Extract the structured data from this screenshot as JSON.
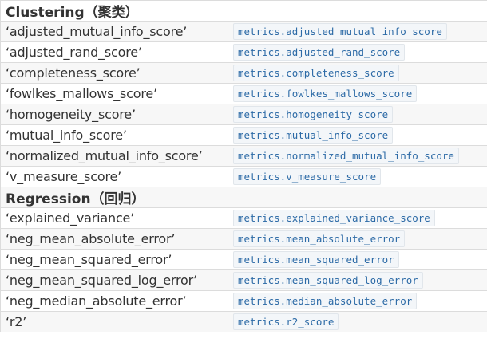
{
  "sections": [
    {
      "title": "Clustering（聚类）",
      "rows": [
        {
          "name": "‘adjusted_mutual_info_score’",
          "func": "metrics.adjusted_mutual_info_score"
        },
        {
          "name": "‘adjusted_rand_score’",
          "func": "metrics.adjusted_rand_score"
        },
        {
          "name": "‘completeness_score’",
          "func": "metrics.completeness_score"
        },
        {
          "name": "‘fowlkes_mallows_score’",
          "func": "metrics.fowlkes_mallows_score"
        },
        {
          "name": "‘homogeneity_score’",
          "func": "metrics.homogeneity_score"
        },
        {
          "name": "‘mutual_info_score’",
          "func": "metrics.mutual_info_score"
        },
        {
          "name": "‘normalized_mutual_info_score’",
          "func": "metrics.normalized_mutual_info_score"
        },
        {
          "name": "‘v_measure_score’",
          "func": "metrics.v_measure_score"
        }
      ]
    },
    {
      "title": "Regression（回归）",
      "rows": [
        {
          "name": "‘explained_variance’",
          "func": "metrics.explained_variance_score"
        },
        {
          "name": "‘neg_mean_absolute_error’",
          "func": "metrics.mean_absolute_error"
        },
        {
          "name": "‘neg_mean_squared_error’",
          "func": "metrics.mean_squared_error"
        },
        {
          "name": "‘neg_mean_squared_log_error’",
          "func": "metrics.mean_squared_log_error"
        },
        {
          "name": "‘neg_median_absolute_error’",
          "func": "metrics.median_absolute_error"
        },
        {
          "name": "‘r2’",
          "func": "metrics.r2_score"
        }
      ]
    }
  ]
}
